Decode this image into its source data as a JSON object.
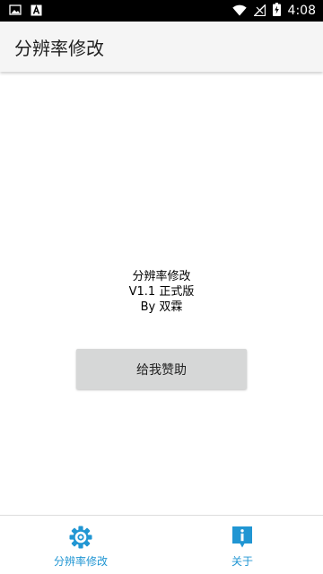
{
  "status_bar": {
    "time": "4:08",
    "icons": [
      "image-icon",
      "app-a-icon",
      "wifi-icon",
      "no-signal-icon",
      "battery-charging-icon"
    ]
  },
  "app_bar": {
    "title": "分辨率修改"
  },
  "main": {
    "info_lines": [
      "分辨率修改",
      "V1.1 正式版",
      "By 双霖"
    ],
    "sponsor_button_label": "给我赞助"
  },
  "bottom_nav": {
    "items": [
      {
        "label": "分辨率修改",
        "icon": "gear-icon"
      },
      {
        "label": "关于",
        "icon": "info-icon"
      }
    ],
    "accent_color": "#2196d3"
  }
}
